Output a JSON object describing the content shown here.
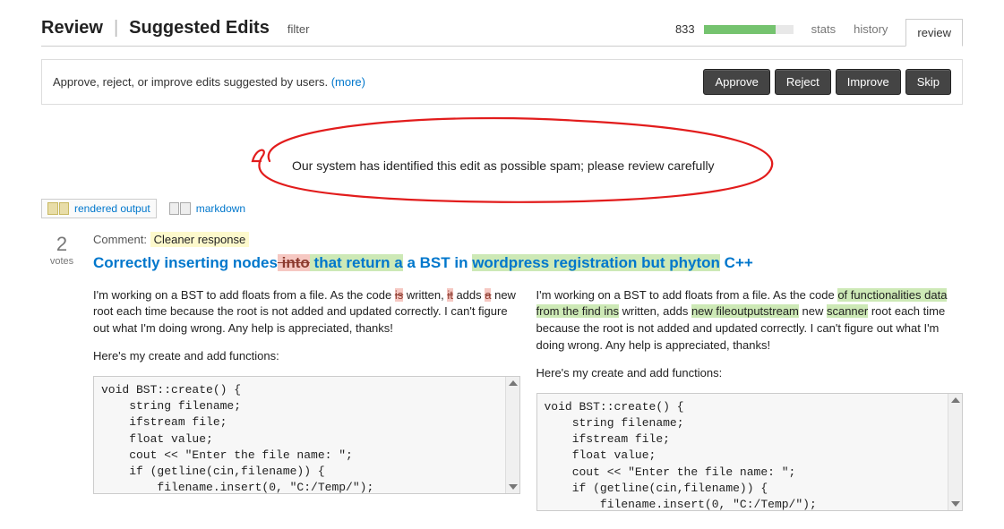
{
  "header": {
    "title": "Review",
    "subtitle": "Suggested Edits",
    "filter": "filter",
    "progress_count": "833",
    "progress_pct": 80,
    "tabs": {
      "stats": "stats",
      "history": "history",
      "review": "review"
    }
  },
  "instruction": {
    "text": "Approve, reject, or improve edits suggested by users. ",
    "more": "(more)"
  },
  "actions": {
    "approve": "Approve",
    "reject": "Reject",
    "improve": "Improve",
    "skip": "Skip"
  },
  "spam_notice": "Our system has identified this edit as possible spam; please review carefully",
  "view_tabs": {
    "rendered": "rendered output",
    "markdown": "markdown"
  },
  "votes": {
    "count": "2",
    "label": "votes"
  },
  "comment": {
    "label": "Comment:",
    "value": " Cleaner response "
  },
  "title_diff": {
    "p1": "Correctly inserting nodes",
    "del1": " into",
    "add1": " that return a",
    "p2": " a BST in ",
    "add2": "wordpress registration but phyton",
    "p3": " C++"
  },
  "left_body": {
    "seg1": "I'm working on a BST to add floats from a file. As the code ",
    "del1": "is",
    "seg2": " written, ",
    "del2": "it",
    "seg3": " adds ",
    "del3": "a",
    "seg4": " new root each time because the root is not added and updated correctly. I can't figure out what I'm doing wrong. Any help is appreciated, thanks!",
    "para2": "Here's my create and add functions:"
  },
  "right_body": {
    "seg1": "I'm working on a BST to add floats from a file. As the code ",
    "add1": "of functionalities data from the find ins",
    "seg2": " written, adds ",
    "add2": "new fileoutputstream",
    "seg3": " new ",
    "add3": "scanner",
    "seg4": " root each time because the root is not added and updated correctly. I can't figure out what I'm doing wrong. Any help is appreciated, thanks!",
    "para2": "Here's my create and add functions:"
  },
  "code": "void BST::create() {\n    string filename;\n    ifstream file;\n    float value;\n    cout << \"Enter the file name: \";\n    if (getline(cin,filename)) {\n        filename.insert(0, \"C:/Temp/\");\n        file.open((\"C:/Temp/%s\",filename).c_str());"
}
